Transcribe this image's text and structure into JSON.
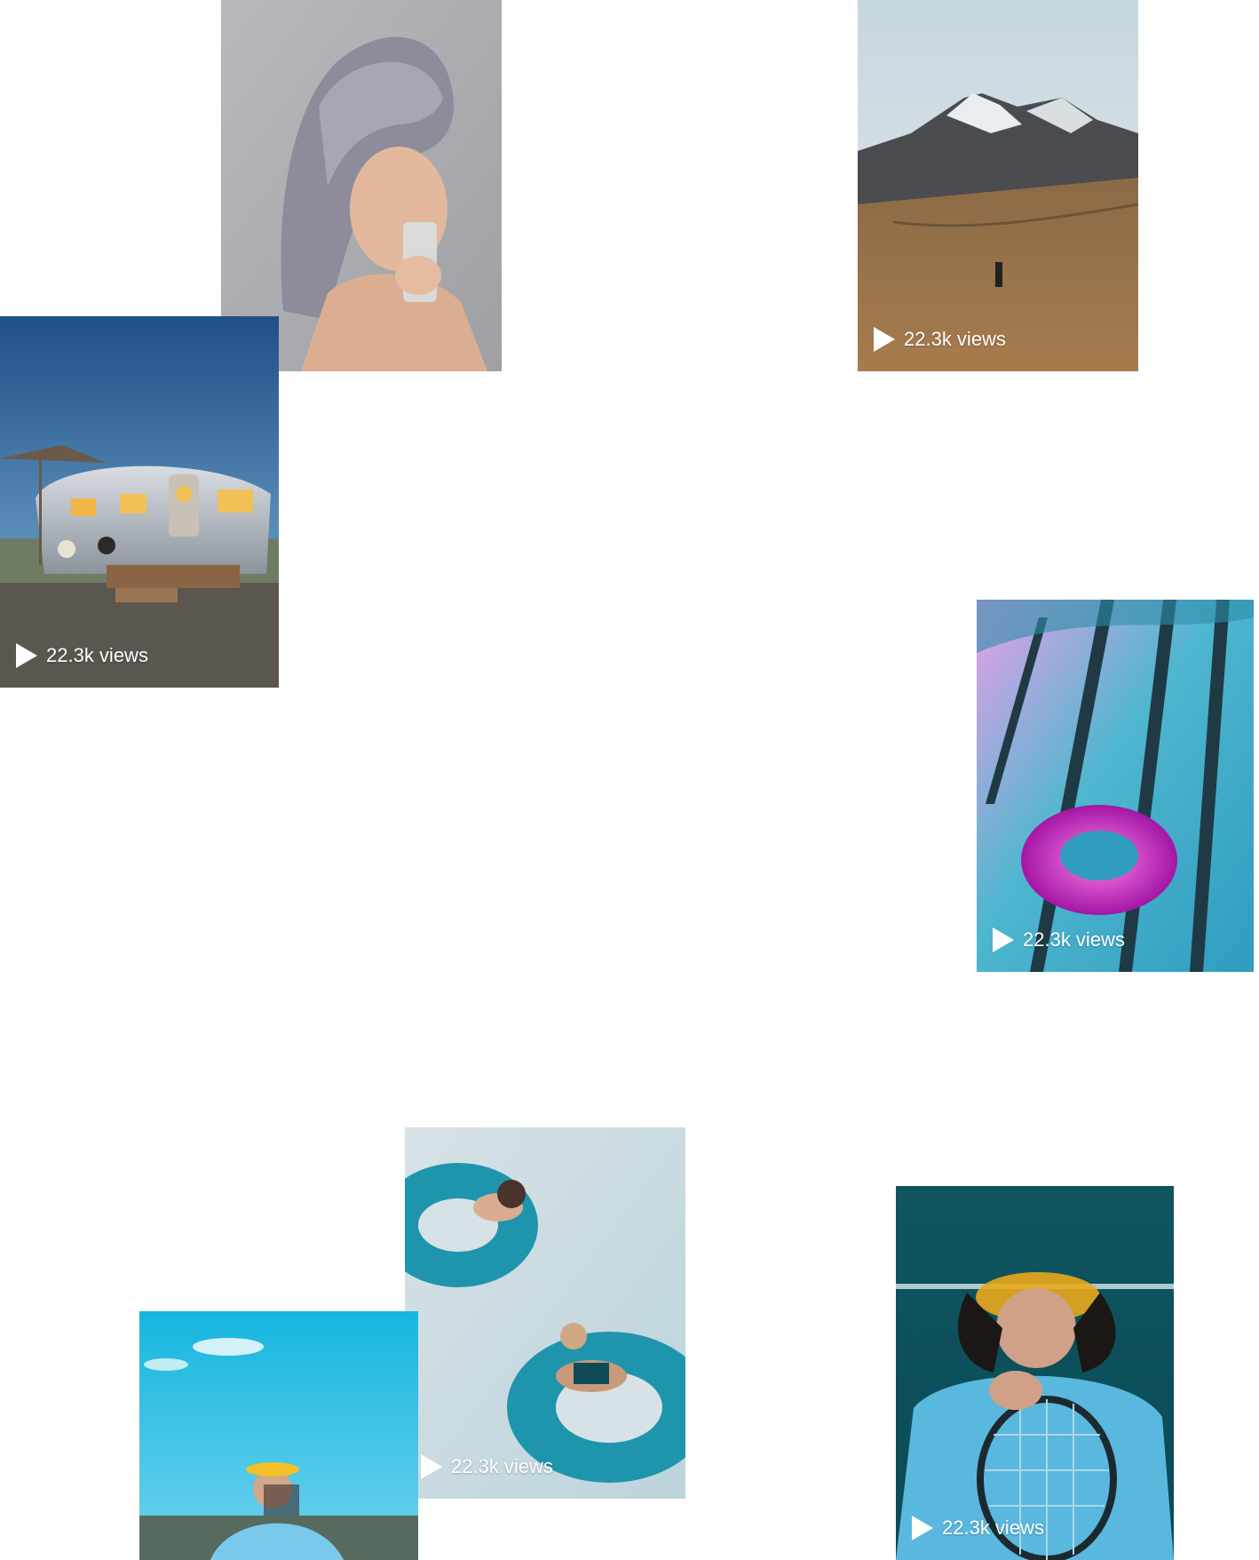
{
  "gallery": {
    "items": [
      {
        "id": "towel",
        "icon": "play-icon",
        "views": ""
      },
      {
        "id": "mountain",
        "icon": "play-icon",
        "views": "22.3k views"
      },
      {
        "id": "trailer",
        "icon": "play-icon",
        "views": "22.3k views"
      },
      {
        "id": "ring",
        "icon": "play-icon",
        "views": "22.3k views"
      },
      {
        "id": "float",
        "icon": "play-icon",
        "views": "22.3k views"
      },
      {
        "id": "visor",
        "icon": "play-icon",
        "views": ""
      },
      {
        "id": "racket",
        "icon": "play-icon",
        "views": "22.3k views"
      }
    ]
  },
  "colors": {
    "background": "#ffffff",
    "badge_text": "#ffffff"
  }
}
